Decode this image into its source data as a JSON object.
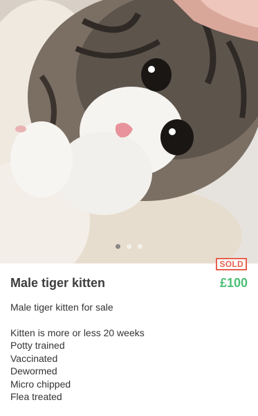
{
  "listing": {
    "title": "Male tiger kitten",
    "price": "£100",
    "status_badge": "SOLD",
    "summary": "Male tiger kitten for sale",
    "details": [
      "Kitten is more or less 20 weeks",
      "Potty trained",
      "Vaccinated",
      "Dewormed",
      "Micro chipped",
      "Flea treated"
    ]
  },
  "carousel": {
    "total_images": 3,
    "active_index": 0
  },
  "colors": {
    "price": "#4cbf75",
    "sold_badge": "#e8604c"
  }
}
